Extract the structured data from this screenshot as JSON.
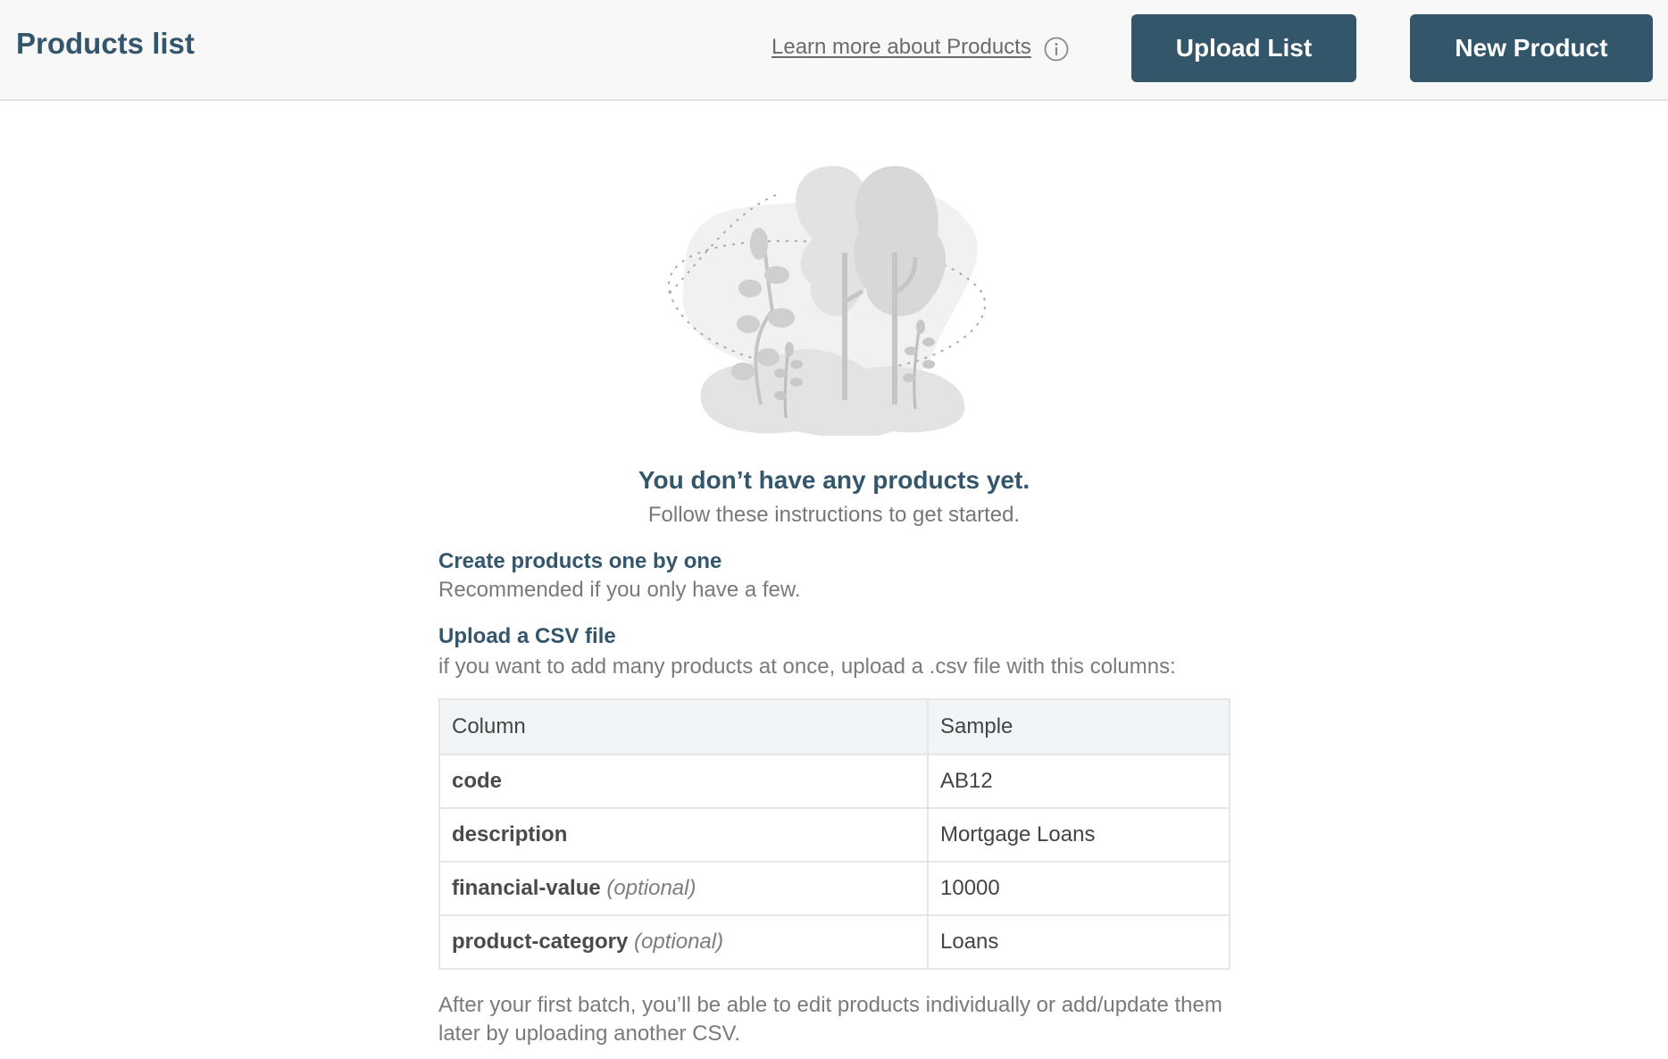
{
  "header": {
    "title": "Products list",
    "learn_more": "Learn more about Products",
    "upload_label": "Upload List",
    "new_label": "New Product"
  },
  "empty_state": {
    "title": "You don’t have any products yet.",
    "subtitle": "Follow these instructions to get started."
  },
  "sections": [
    {
      "heading": "Create products one by one",
      "text": "Recommended if you only have a few."
    },
    {
      "heading": "Upload a CSV file",
      "text": "if you want to add many products at once, upload a .csv file with this columns:"
    }
  ],
  "table": {
    "headers": [
      "Column",
      "Sample"
    ],
    "optional_label": "(optional)",
    "rows": [
      {
        "column": "code",
        "optional": false,
        "sample": "AB12"
      },
      {
        "column": "description",
        "optional": false,
        "sample": "Mortgage Loans"
      },
      {
        "column": "financial-value",
        "optional": true,
        "sample": "10000"
      },
      {
        "column": "product-category",
        "optional": true,
        "sample": "Loans"
      }
    ]
  },
  "footer_note": "After your first batch, you’ll be able to edit products individually or add/update them later by uploading another CSV.",
  "colors": {
    "brand": "#34566b",
    "header_bg": "#f8f8f8",
    "table_header_bg": "#f2f5f7"
  },
  "icons": {
    "info": "info-circle-icon",
    "illustration": "empty-products-illustration"
  }
}
